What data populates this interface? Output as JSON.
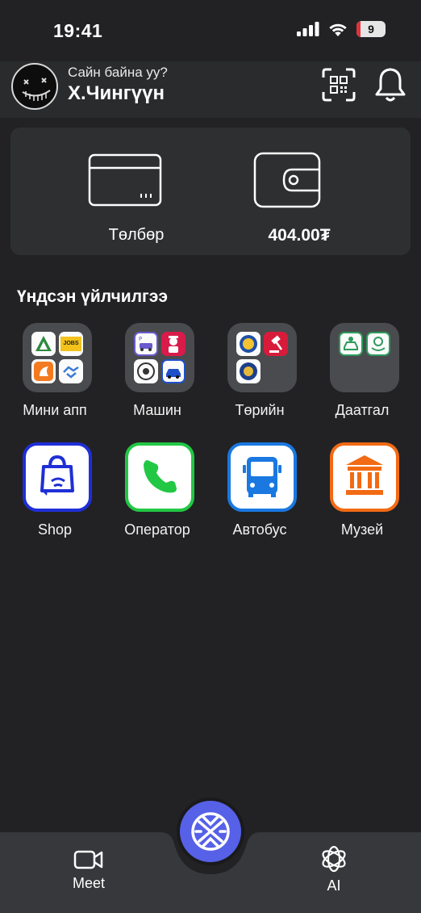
{
  "status": {
    "time": "19:41",
    "battery": "9"
  },
  "header": {
    "greeting": "Сайн байна уу?",
    "user_name": "Х.Чингүүн"
  },
  "wallet": {
    "payment_label": "Төлбөр",
    "balance_label": "404.00₮"
  },
  "services": {
    "title": "Үндсэн үйлчилгээ",
    "folders": [
      {
        "label": "Мини апп"
      },
      {
        "label": "Машин"
      },
      {
        "label": "Төрийн"
      },
      {
        "label": "Даатгал"
      }
    ],
    "apps": [
      {
        "label": "Shop",
        "color": "#1f2fd6"
      },
      {
        "label": "Оператор",
        "color": "#22c744"
      },
      {
        "label": "Автобус",
        "color": "#1a78e0"
      },
      {
        "label": "Музей",
        "color": "#f26a14"
      }
    ],
    "mini_texts": {
      "jobs": "JOBS"
    }
  },
  "bottom_nav": {
    "meet_label": "Meet",
    "ai_label": "AI"
  },
  "colors": {
    "accent": "#5661e8",
    "background": "#222224",
    "card": "#2e2f31"
  }
}
